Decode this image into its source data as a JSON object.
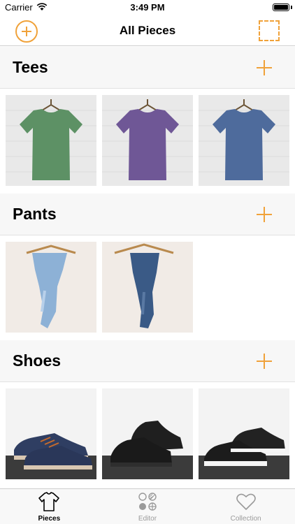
{
  "status_bar": {
    "carrier": "Carrier",
    "time": "3:49 PM",
    "battery_level": 1.0
  },
  "nav": {
    "title": "All Pieces"
  },
  "colors": {
    "accent": "#f0a23a",
    "tab_inactive": "#9a9a9a"
  },
  "sections": [
    {
      "title": "Tees",
      "items": [
        {
          "name": "green-tee",
          "color": "#5d9165"
        },
        {
          "name": "purple-tee",
          "color": "#6f5796"
        },
        {
          "name": "blue-tee",
          "color": "#4e6b9c"
        }
      ]
    },
    {
      "title": "Pants",
      "items": [
        {
          "name": "light-jeans",
          "color": "#8db1d6"
        },
        {
          "name": "dark-jeans",
          "color": "#3a5a86"
        }
      ]
    },
    {
      "title": "Shoes",
      "items": [
        {
          "name": "navy-sneakers",
          "color": "#2f3e62"
        },
        {
          "name": "black-high-tops",
          "color": "#1f1f1f"
        },
        {
          "name": "black-sneakers",
          "color": "#222222"
        }
      ]
    }
  ],
  "tabs": [
    {
      "label": "Pieces",
      "icon": "tshirt-icon",
      "active": true
    },
    {
      "label": "Editor",
      "icon": "editor-grid-icon",
      "active": false
    },
    {
      "label": "Collection",
      "icon": "heart-icon",
      "active": false
    }
  ]
}
